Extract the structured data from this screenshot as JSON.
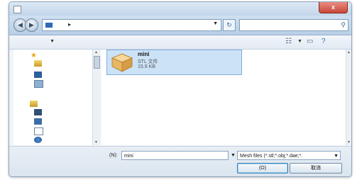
{
  "window": {
    "title": "",
    "close_label": "x"
  },
  "navbar": {
    "back_icon": "back-arrow-icon",
    "forward_icon": "forward-arrow-icon",
    "address_separator": "▸",
    "refresh_icon": "refresh-icon",
    "search_placeholder": ""
  },
  "toolbar": {
    "organize_label": "",
    "views_glyph": "☷",
    "pane_glyph": "▭",
    "help_glyph": "?"
  },
  "file": {
    "name": "mini",
    "type": "STL 文件",
    "size": "15.9 KB",
    "icon": "package-box-icon"
  },
  "footer": {
    "filename_label": "(N):",
    "filename_value": "mini",
    "filter_value": "Mesh files (*.stl;*.obj;*.dae;*.",
    "open_label": "(O)",
    "cancel_label": "取消"
  },
  "colors": {
    "selection": "#cce3f7",
    "titlebar": "#c3d6ea",
    "close": "#c8473a"
  }
}
